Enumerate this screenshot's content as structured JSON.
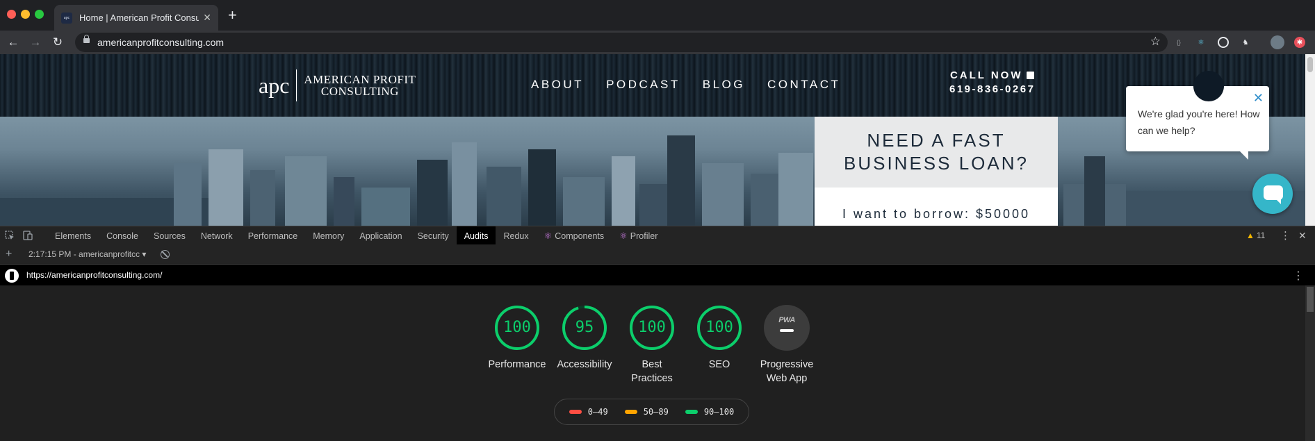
{
  "browser": {
    "tab_title": "Home | American Profit Consulting",
    "tab_favicon": "apc",
    "url": "americanprofitconsulting.com"
  },
  "site": {
    "logo_mark": "apc",
    "logo_line1": "AMERICAN PROFIT",
    "logo_line2": "CONSULTING",
    "nav": [
      "ABOUT",
      "PODCAST",
      "BLOG",
      "CONTACT"
    ],
    "call_label": "CALL NOW",
    "phone": "619-836-0267",
    "loan_title": "NEED A FAST BUSINESS LOAN?",
    "loan_borrow": "I want to borrow: $50000",
    "chat_message": "We're glad you're here! How can we help?"
  },
  "devtools": {
    "tabs": [
      "Elements",
      "Console",
      "Sources",
      "Network",
      "Performance",
      "Memory",
      "Application",
      "Security",
      "Audits",
      "Redux",
      "Components",
      "Profiler"
    ],
    "active_tab": "Audits",
    "warning_count": "11",
    "report_label": "2:17:15 PM - americanprofitcc ▾",
    "audit_url": "https://americanprofitconsulting.com/"
  },
  "lighthouse": {
    "scores": [
      {
        "label": "Performance",
        "value": "100",
        "fraction": 1.0
      },
      {
        "label": "Accessibility",
        "value": "95",
        "fraction": 0.95
      },
      {
        "label": "Best Practices",
        "value": "100",
        "fraction": 1.0
      },
      {
        "label": "SEO",
        "value": "100",
        "fraction": 1.0
      }
    ],
    "pwa_label": "Progressive Web App",
    "pwa_badge": "PWA",
    "legend": [
      {
        "range": "0–49",
        "color": "#ff4e42"
      },
      {
        "range": "50–89",
        "color": "#ffa400"
      },
      {
        "range": "90–100",
        "color": "#0cce6b"
      }
    ],
    "pass_color": "#0cce6b"
  }
}
